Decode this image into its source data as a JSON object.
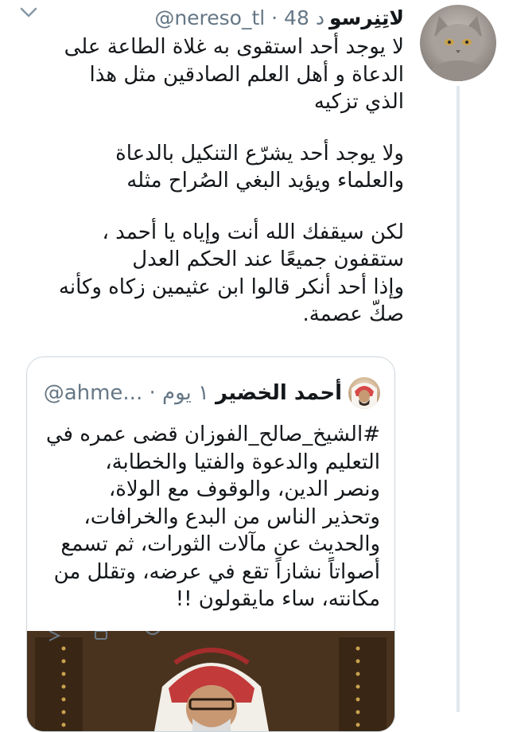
{
  "tweet": {
    "display_name": "لاتِنِرسو",
    "meta": "@nereso_tl · 48 د",
    "paragraphs": [
      {
        "lines": [
          "لا يوجد أحد استقوى به غلاة الطاعة على",
          "الدعاة و أهل العلم الصادقين مثل هذا",
          "الذي تزكيه"
        ]
      },
      {
        "lines": [
          "ولا يوجد أحد يشرّع التنكيل بالدعاة",
          "والعلماء ويؤيد البغي الصُراح مثله"
        ]
      },
      {
        "lines": [
          "لكن سيقفك الله أنت وإياه يا أحمد ،",
          "ستقفون جميعًا عند الحكم العدل",
          "وإذا أحد أنكر قالوا ابن عثيمين زكاه وكأنه",
          "صكّ عصمة."
        ]
      }
    ]
  },
  "quoted": {
    "display_name": "أحمد الخضير",
    "meta": "@ahme... · ١ يوم",
    "lines": [
      "#الشيخ_صالح_الفوزان قضى عمره في",
      "التعليم والدعوة والفتيا والخطابة،",
      "ونصر الدين، والوقوف مع الولاة،",
      "وتحذير الناس من البدع والخرافات،",
      "والحديث عن مآلات الثورات، ثم تسمع",
      "أصواتاً نشازاً تقع في عرضه، وتقلل من",
      "مكانته، ساء مايقولون !!"
    ]
  },
  "icons": {
    "menu": "chevron-down-icon",
    "avatar": "cat-avatar",
    "quoted_avatar": "user-avatar"
  },
  "colors": {
    "text": "#14171a",
    "secondary": "#657786",
    "border": "#ccd6dd"
  }
}
